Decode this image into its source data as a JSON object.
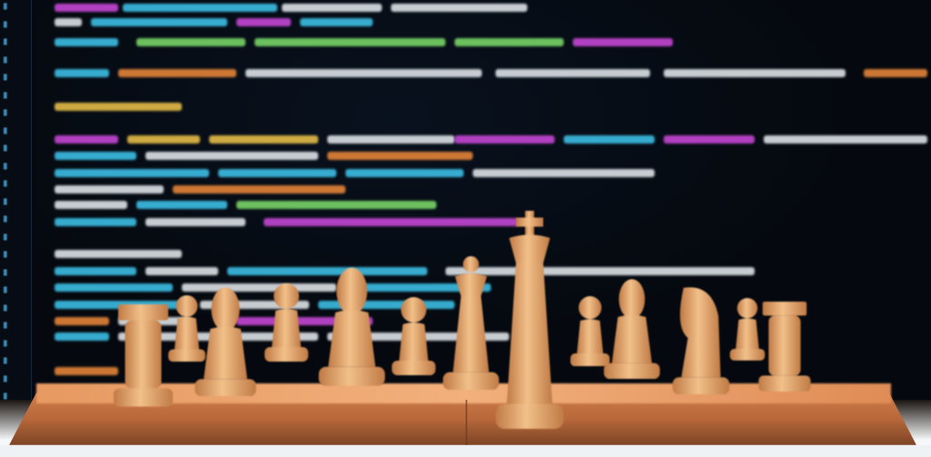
{
  "image": {
    "subject": "chess pieces on wooden board in front of blurred code editor",
    "palette": {
      "background": "#05090f",
      "wood_light": "#f2c08a",
      "wood_dark": "#c07a45",
      "code_cyan": "#3fc8f0",
      "code_magenta": "#d04ae0",
      "code_yellow": "#f2c64a",
      "code_orange": "#f08a3a",
      "code_green": "#7ee06a",
      "code_white": "#e8eef2"
    }
  },
  "pieces": [
    "rook",
    "pawn",
    "bishop",
    "pawn",
    "bishop",
    "pawn",
    "queen",
    "king",
    "pawn",
    "bishop",
    "knight",
    "pawn",
    "rook"
  ]
}
